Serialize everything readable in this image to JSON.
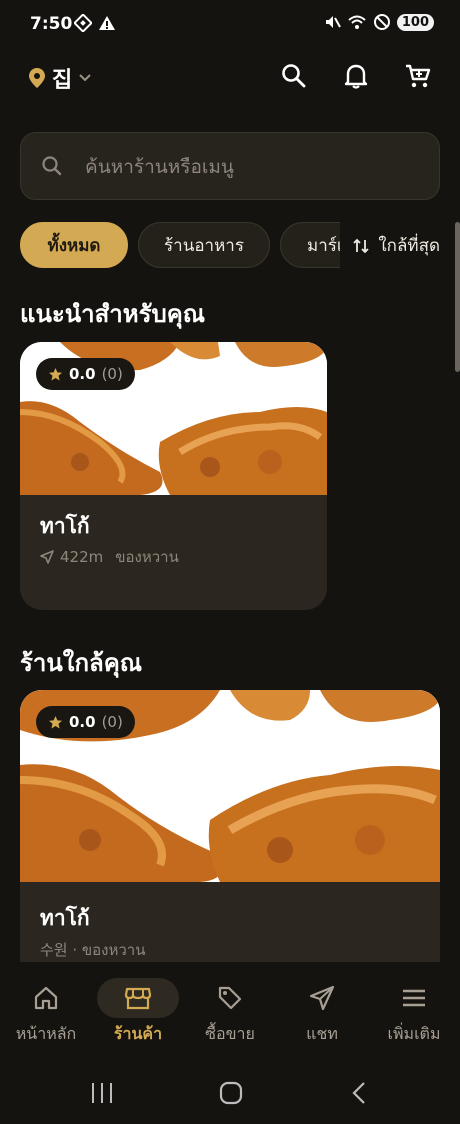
{
  "status": {
    "time": "7:50",
    "battery": "100"
  },
  "topbar": {
    "location_label": "집"
  },
  "search": {
    "placeholder": "ค้นหาร้านหรือเมนู"
  },
  "filters": {
    "chips": [
      "ทั้งหมด",
      "ร้านอาหาร",
      "มาร์เ"
    ],
    "active_index": 0,
    "sort_label": "ใกล้ที่สุด"
  },
  "recommended": {
    "title": "แนะนำสำหรับคุณ",
    "card": {
      "rating": "0.0",
      "rating_count": "(0)",
      "name": "ทาโก้",
      "distance": "422m",
      "category": "ของหวาน"
    }
  },
  "nearby": {
    "title": "ร้านใกล้คุณ",
    "card": {
      "rating": "0.0",
      "rating_count": "(0)",
      "name": "ทาโก้",
      "meta": "수원 · ของหวาน"
    }
  },
  "bottom_nav": {
    "items": [
      {
        "label": "หน้าหลัก",
        "icon": "home-icon"
      },
      {
        "label": "ร้านค้า",
        "icon": "store-icon"
      },
      {
        "label": "ซื้อขาย",
        "icon": "tag-icon"
      },
      {
        "label": "แชท",
        "icon": "send-icon"
      },
      {
        "label": "เพิ่มเติม",
        "icon": "menu-icon"
      }
    ],
    "active_index": 1
  },
  "colors": {
    "background": "#15130f",
    "accent": "#d3aa53",
    "card": "#2b2720"
  }
}
